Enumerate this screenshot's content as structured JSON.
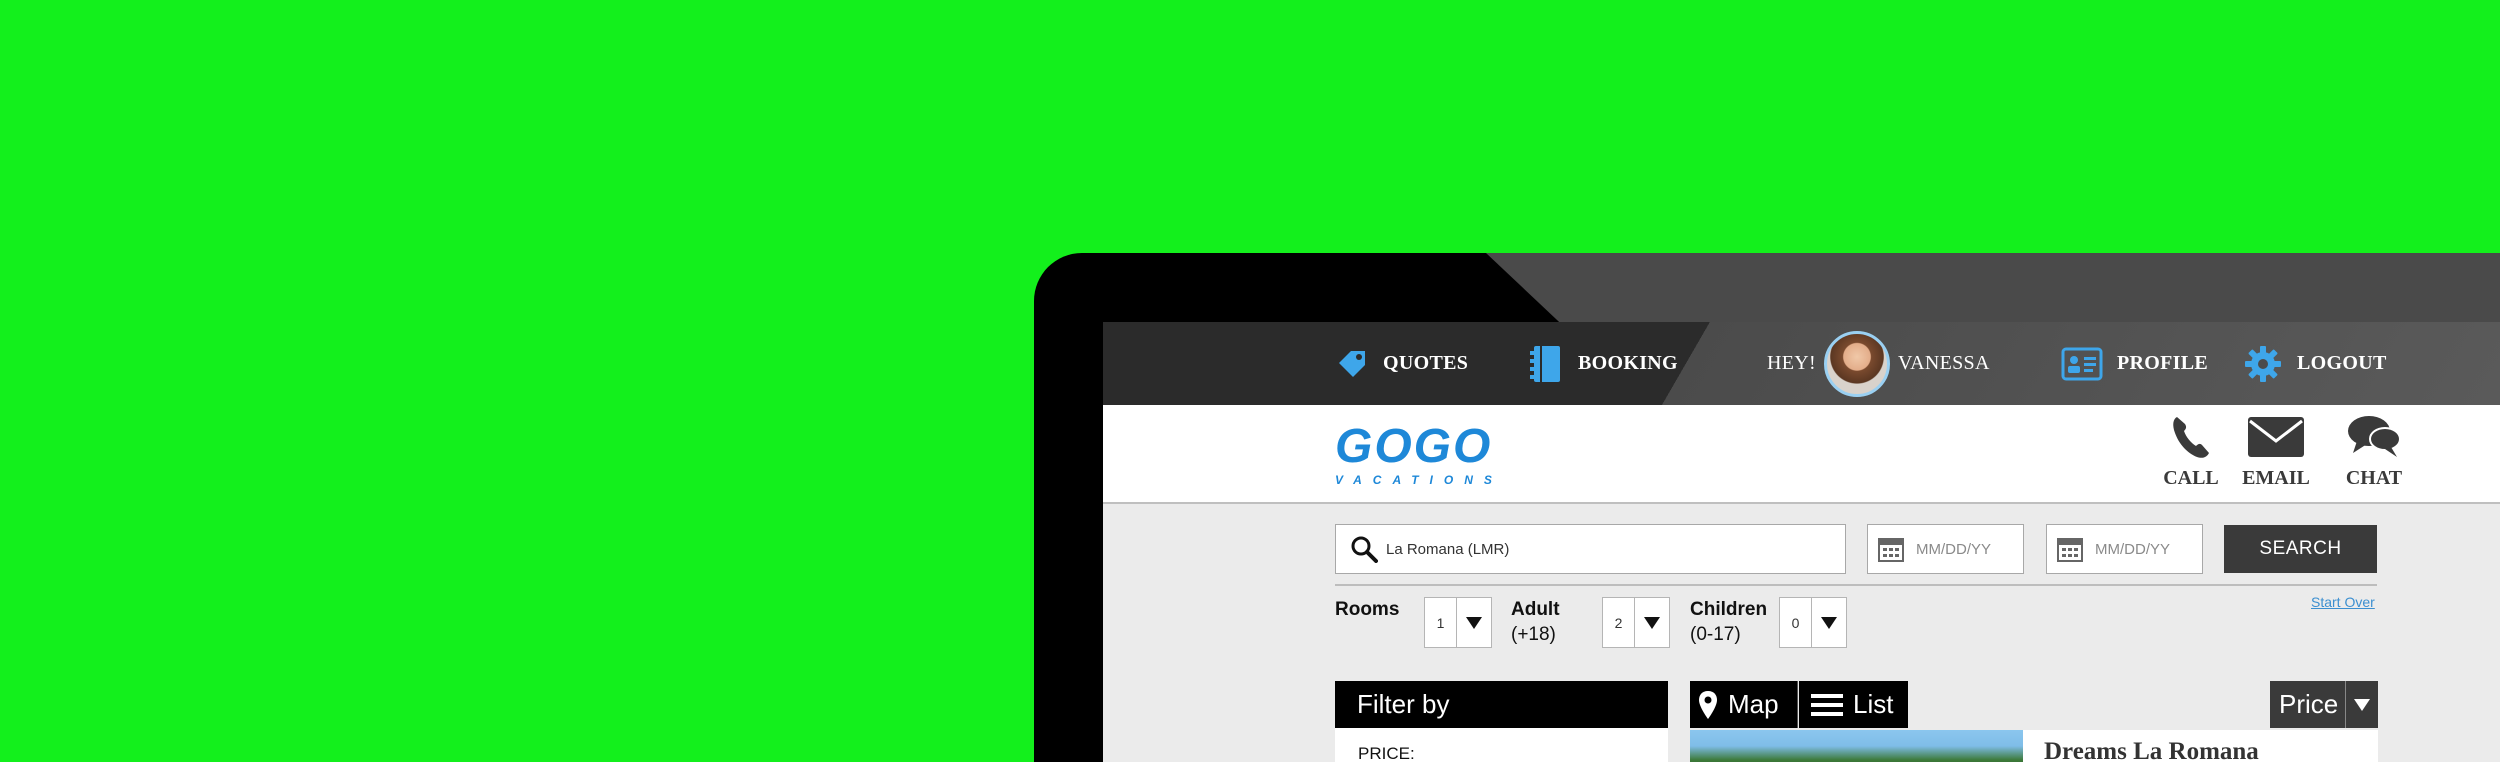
{
  "topnav": {
    "quotes": "QUOTES",
    "booking": "BOOKING",
    "greeting": "HEY!",
    "user_name": "VANESSA",
    "profile": "PROFILE",
    "logout": "LOGOUT"
  },
  "logo": {
    "main": "GOGO",
    "sub": "VACATIONS"
  },
  "contact": {
    "call": "CALL",
    "email": "EMAIL",
    "chat": "CHAT"
  },
  "search": {
    "destination": "La Romana (LMR)",
    "checkin_placeholder": "MM/DD/YY",
    "checkout_placeholder": "MM/DD/YY",
    "button": "SEARCH",
    "start_over": "Start Over"
  },
  "occupancy": {
    "rooms_label": "Rooms",
    "rooms_value": "1",
    "adult_label": "Adult",
    "adult_sub": "(+18)",
    "adult_value": "2",
    "children_label": "Children",
    "children_sub": "(0-17)",
    "children_value": "0"
  },
  "filter": {
    "title": "Filter by",
    "price_label": "PRICE:"
  },
  "view": {
    "map": "Map",
    "list": "List",
    "sort": "Price"
  },
  "result": {
    "title": "Dreams La Romana"
  },
  "colors": {
    "accent": "#1e88d8",
    "background": "#13f01c",
    "nav": "#2b2b2b"
  }
}
